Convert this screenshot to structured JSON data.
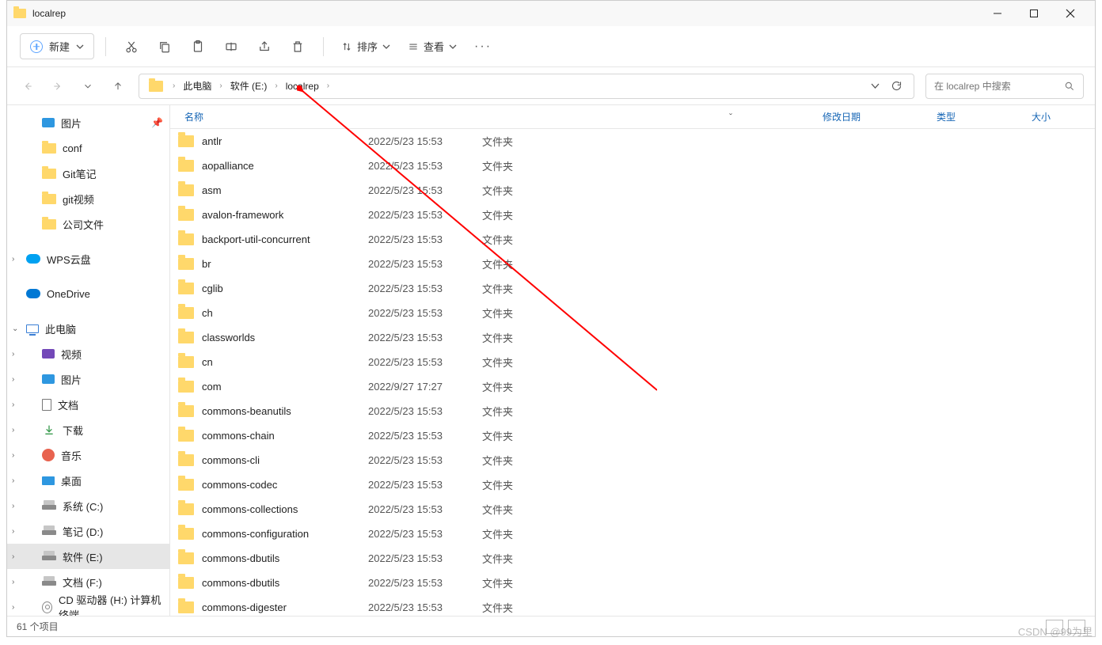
{
  "window": {
    "title": "localrep"
  },
  "toolbar": {
    "new_label": "新建",
    "sort_label": "排序",
    "view_label": "查看"
  },
  "breadcrumb": {
    "segs": [
      "此电脑",
      "软件 (E:)",
      "localrep"
    ]
  },
  "search": {
    "placeholder": "在 localrep 中搜索"
  },
  "nav_quick": [
    {
      "name": "图片",
      "type": "pic",
      "pin": true
    },
    {
      "name": "conf",
      "type": "folder"
    },
    {
      "name": "Git笔记",
      "type": "folder"
    },
    {
      "name": "git视频",
      "type": "folder"
    },
    {
      "name": "公司文件",
      "type": "folder"
    }
  ],
  "nav_wps": {
    "label": "WPS云盘"
  },
  "nav_onedrive": {
    "label": "OneDrive"
  },
  "nav_pc": {
    "label": "此电脑",
    "children": [
      {
        "name": "视频",
        "type": "video"
      },
      {
        "name": "图片",
        "type": "pic"
      },
      {
        "name": "文档",
        "type": "doc"
      },
      {
        "name": "下载",
        "type": "download"
      },
      {
        "name": "音乐",
        "type": "music"
      },
      {
        "name": "桌面",
        "type": "desktop"
      },
      {
        "name": "系统 (C:)",
        "type": "drive"
      },
      {
        "name": "笔记 (D:)",
        "type": "drive"
      },
      {
        "name": "软件 (E:)",
        "type": "drive",
        "selected": true
      },
      {
        "name": "文档 (F:)",
        "type": "drive"
      },
      {
        "name": "CD 驱动器 (H:) 计算机终端",
        "type": "cd"
      }
    ]
  },
  "columns": {
    "name": "名称",
    "date": "修改日期",
    "type": "类型",
    "size": "大小"
  },
  "type_folder": "文件夹",
  "rows": [
    {
      "name": "antlr",
      "date": "2022/5/23 15:53"
    },
    {
      "name": "aopalliance",
      "date": "2022/5/23 15:53"
    },
    {
      "name": "asm",
      "date": "2022/5/23 15:53"
    },
    {
      "name": "avalon-framework",
      "date": "2022/5/23 15:53"
    },
    {
      "name": "backport-util-concurrent",
      "date": "2022/5/23 15:53"
    },
    {
      "name": "br",
      "date": "2022/5/23 15:53"
    },
    {
      "name": "cglib",
      "date": "2022/5/23 15:53"
    },
    {
      "name": "ch",
      "date": "2022/5/23 15:53"
    },
    {
      "name": "classworlds",
      "date": "2022/5/23 15:53"
    },
    {
      "name": "cn",
      "date": "2022/5/23 15:53"
    },
    {
      "name": "com",
      "date": "2022/9/27 17:27"
    },
    {
      "name": "commons-beanutils",
      "date": "2022/5/23 15:53"
    },
    {
      "name": "commons-chain",
      "date": "2022/5/23 15:53"
    },
    {
      "name": "commons-cli",
      "date": "2022/5/23 15:53"
    },
    {
      "name": "commons-codec",
      "date": "2022/5/23 15:53"
    },
    {
      "name": "commons-collections",
      "date": "2022/5/23 15:53"
    },
    {
      "name": "commons-configuration",
      "date": "2022/5/23 15:53"
    },
    {
      "name": "commons-dbutils",
      "date": "2022/5/23 15:53"
    },
    {
      "name": "commons-dbutils",
      "date": "2022/5/23 15:53"
    },
    {
      "name": "commons-digester",
      "date": "2022/5/23 15:53"
    }
  ],
  "status": {
    "count": "61 个项目"
  },
  "watermark": "CSDN @99为里"
}
